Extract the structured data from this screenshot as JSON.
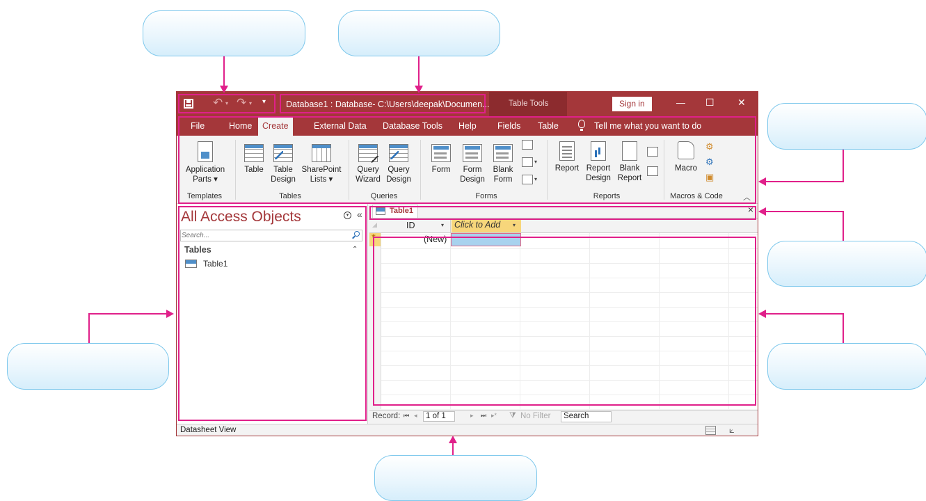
{
  "titlebar": {
    "title": "Database1 : Database- C:\\Users\\deepak\\Documen...",
    "table_tools": "Table Tools",
    "sign_in": "Sign in",
    "minimize": "—",
    "restore": "☐",
    "close": "✕"
  },
  "tabs": [
    "File",
    "Home",
    "Create",
    "External Data",
    "Database Tools",
    "Help",
    "Fields",
    "Table"
  ],
  "tell_me": "Tell me what you want to do",
  "ribbon": {
    "groups": {
      "templates": "Templates",
      "tables": "Tables",
      "queries": "Queries",
      "forms": "Forms",
      "reports": "Reports",
      "macros": "Macros & Code"
    },
    "buttons": {
      "app_parts_1": "Application",
      "app_parts_2": "Parts ▾",
      "table": "Table",
      "table_design_1": "Table",
      "table_design_2": "Design",
      "sharepoint_1": "SharePoint",
      "sharepoint_2": "Lists ▾",
      "query_wizard_1": "Query",
      "query_wizard_2": "Wizard",
      "query_design_1": "Query",
      "query_design_2": "Design",
      "form": "Form",
      "form_design_1": "Form",
      "form_design_2": "Design",
      "blank_form_1": "Blank",
      "blank_form_2": "Form",
      "report": "Report",
      "report_design_1": "Report",
      "report_design_2": "Design",
      "blank_report_1": "Blank",
      "blank_report_2": "Report",
      "macro": "Macro"
    }
  },
  "nav": {
    "title": "All Access Objects",
    "search_placeholder": "Search...",
    "section": "Tables",
    "items": [
      "Table1"
    ]
  },
  "doc_tab": {
    "label": "Table1",
    "close": "×"
  },
  "datasheet": {
    "col_id": "ID",
    "col_add": "Click to Add",
    "new_row": "(New)"
  },
  "record_bar": {
    "label": "Record:",
    "position": "1 of 1",
    "filter": "No Filter",
    "search": "Search"
  },
  "status": {
    "view": "Datasheet View"
  },
  "colors": {
    "brand": "#a4373a",
    "annotation": "#e0208a",
    "callout_border": "#7ec8ec"
  }
}
